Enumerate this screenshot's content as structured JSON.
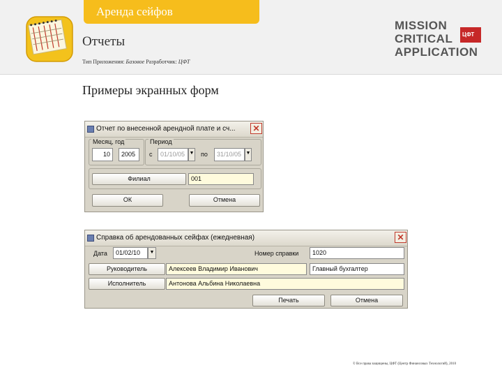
{
  "header": {
    "tab_label": "Аренда сейфов",
    "title": "Отчеты",
    "meta_prefix": "Тип Приложения:",
    "meta_type": "Базовое",
    "meta_dev_prefix": "Разработчик:",
    "meta_dev": "ЦФТ"
  },
  "logo": {
    "line1": "MISSION",
    "line2": "CRITICAL",
    "line3": "APPLICATION",
    "badge": "ЦФТ"
  },
  "section_title": "Примеры экранных форм",
  "window1": {
    "title": "Отчет по внесенной арендной плате и сч...",
    "close": "✕",
    "month_year_label": "Месяц, год",
    "month": "10",
    "year": "2005",
    "period_label": "Период",
    "from_label": "с",
    "from_value": "01/10/05",
    "to_label": "по",
    "to_value": "31/10/05",
    "branch_button": "Филиал",
    "branch_value": "001",
    "ok_button": "ОК",
    "cancel_button": "Отмена"
  },
  "window2": {
    "title": "Справка об арендованных сейфах (ежедневная)",
    "close": "✕",
    "date_label": "Дата",
    "date_value": "01/02/10",
    "ref_number_label": "Номер справки",
    "ref_number_value": "1020",
    "head_button": "Руководитель",
    "head_name": "Алексеев Владимир Иванович",
    "head_position": "Главный бухгалтер",
    "executor_button": "Исполнитель",
    "executor_name": "Антонова Альбина Николаевна",
    "print_button": "Печать",
    "cancel_button": "Отмена"
  },
  "footer": "© Все права защищены, ЦФТ (Центр Финансовых Технологий), 2010"
}
